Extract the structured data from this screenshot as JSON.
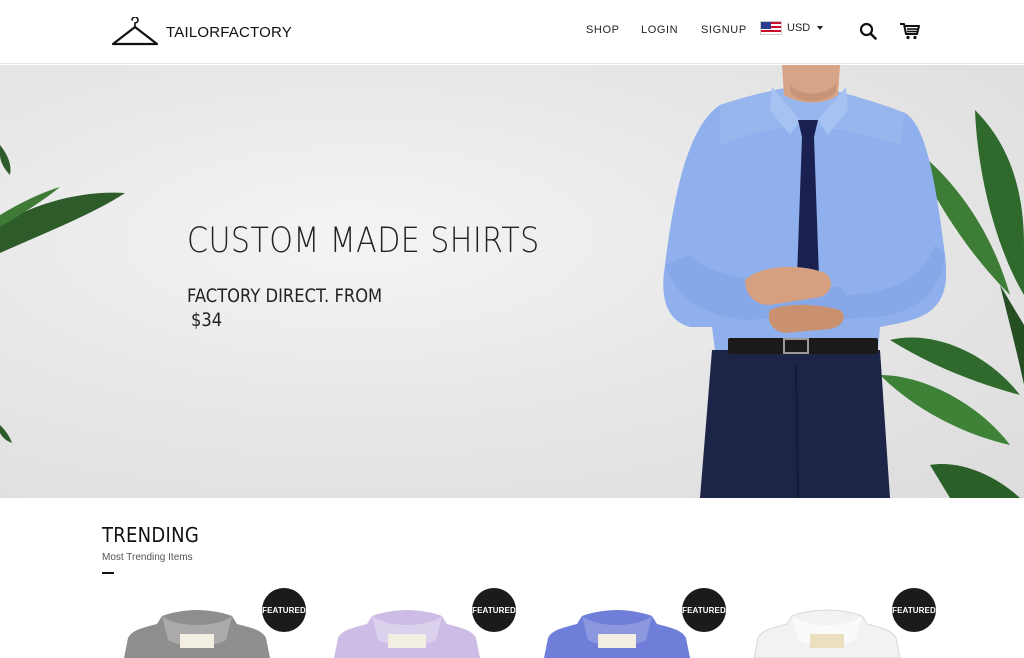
{
  "brand": {
    "name": "TAILORFACTORY"
  },
  "nav": {
    "shop": "SHOP",
    "login": "LOGIN",
    "signup": "SIGNUP"
  },
  "currency": {
    "code": "USD",
    "flag": "us-flag-icon"
  },
  "icons": {
    "search": "search-icon",
    "cart": "cart-icon"
  },
  "hero": {
    "title": "CUSTOM MADE SHIRTS",
    "subtitle": "FACTORY DIRECT. FROM",
    "price": "$34"
  },
  "trending": {
    "title": "TRENDING",
    "subtitle": "Most Trending Items",
    "products": [
      {
        "badge": "FEATURED",
        "color": "#8e8e8e"
      },
      {
        "badge": "FEATURED",
        "color": "#cdbde6"
      },
      {
        "badge": "FEATURED",
        "color": "#6f7ed8"
      },
      {
        "badge": "FEATURED",
        "color": "#f2f2f4"
      }
    ]
  }
}
